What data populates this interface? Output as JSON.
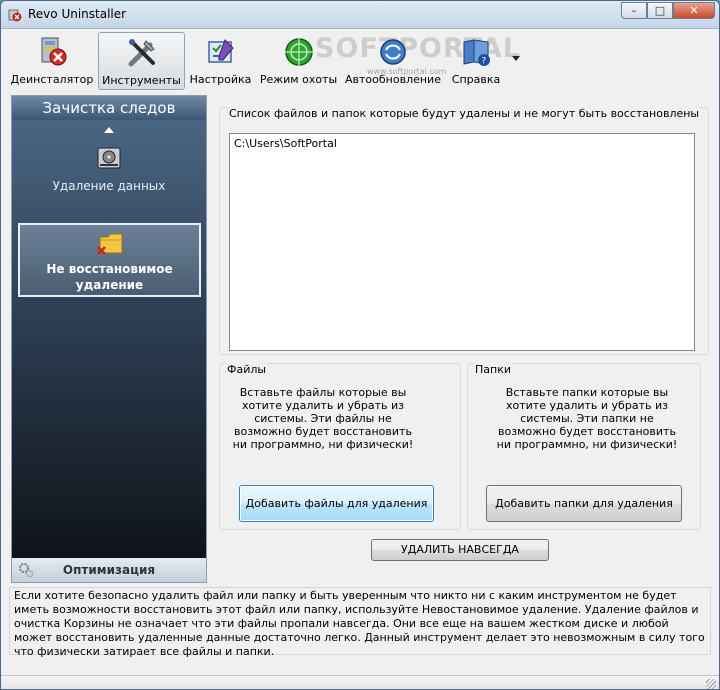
{
  "window": {
    "title": "Revo Uninstaller",
    "minimize_glyph": "–",
    "maximize_glyph": "□",
    "close_glyph": "✕"
  },
  "toolbar": {
    "items": [
      {
        "label": "Деинсталятор",
        "icon": "uninstaller-icon",
        "active": false
      },
      {
        "label": "Инструменты",
        "icon": "tools-icon",
        "active": true
      },
      {
        "label": "Настройка",
        "icon": "settings-icon",
        "active": false
      },
      {
        "label": "Режим охоты",
        "icon": "hunter-mode-icon",
        "active": false
      },
      {
        "label": "Автообновление",
        "icon": "autoupdate-icon",
        "active": false
      },
      {
        "label": "Справка",
        "icon": "help-icon",
        "active": false
      }
    ],
    "watermark": "SOFTPORTAL",
    "watermark_sub": "www.softportal.com"
  },
  "sidebar": {
    "header": "Зачистка следов",
    "items": [
      {
        "label": "Удаление данных",
        "icon": "hard-drive-icon",
        "selected": false
      },
      {
        "label": "Не восстановимое удаление",
        "icon": "folder-delete-icon",
        "selected": true
      }
    ],
    "footer": {
      "label": "Оптимизация",
      "icon": "gears-icon"
    }
  },
  "main": {
    "list_caption": "Список файлов и папок которые будут удалены и не могут быть восстановлены",
    "list_entries": [
      "C:\\Users\\SoftPortal"
    ],
    "files_group": {
      "legend": "Файлы",
      "description": "Вставьте файлы которые вы хотите удалить и убрать из системы. Эти файлы не возможно будет восстановить ни программно, ни физически!",
      "button": "Добавить файлы для удаления"
    },
    "folders_group": {
      "legend": "Папки",
      "description": "Вставьте папки которые вы хотите удалить и убрать из системы. Эти папки не возможно будет восстановить ни программно, ни физически!",
      "button": "Добавить папки для удаления"
    },
    "delete_button": "УДАЛИТЬ НАВСЕГДА"
  },
  "info_text": "Если хотите безопасно удалить файл или папку и быть уверенным что никто ни с каким инструментом не будет иметь возможности восстановить этот файл или папку, используйте Невостановимое удаление. Удаление файлов и очистка Корзины не означает что эти файлы пропали навсегда. Они все еще на вашем жестком диске и любой может восстановить удаленные данные достаточно легко. Данный инструмент делает это невозможным в силу того что физически затирает все файлы и папки."
}
